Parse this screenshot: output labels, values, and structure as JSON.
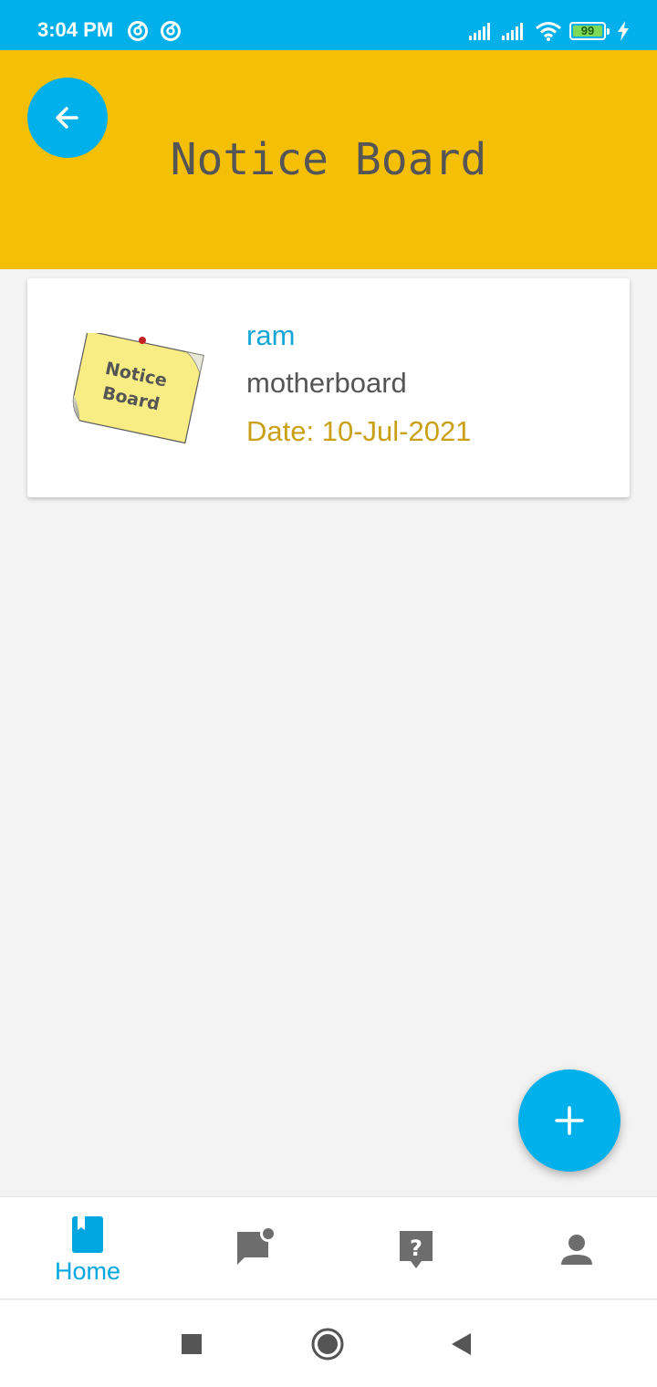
{
  "status_bar": {
    "time": "3:04 PM",
    "battery_level": "99",
    "background_color": "#00b0ea",
    "icons": [
      "app-notification-icon",
      "app-notification-icon",
      "signal-icon",
      "signal-icon",
      "wifi-icon",
      "battery-icon",
      "charging-icon"
    ]
  },
  "header": {
    "title": "Notice Board",
    "background_color": "#f5bf05",
    "back_icon": "arrow-left-icon"
  },
  "notices": [
    {
      "thumbnail_text_line1": "Notice",
      "thumbnail_text_line2": "Board",
      "author": "ram",
      "title": "motherboard",
      "date": "Date: 10-Jul-2021"
    }
  ],
  "fab": {
    "icon": "plus-icon",
    "color": "#00b0ea"
  },
  "bottom_nav": {
    "items": [
      {
        "icon": "bookmark-book-icon",
        "label": "Home",
        "active": true
      },
      {
        "icon": "chat-notification-icon",
        "label": "",
        "active": false
      },
      {
        "icon": "help-question-icon",
        "label": "",
        "active": false
      },
      {
        "icon": "person-icon",
        "label": "",
        "active": false
      }
    ],
    "active_color": "#00a6e0",
    "inactive_color": "#6d6d6d"
  },
  "system_nav": {
    "icons": [
      "recents-square-icon",
      "home-circle-icon",
      "back-triangle-icon"
    ]
  }
}
